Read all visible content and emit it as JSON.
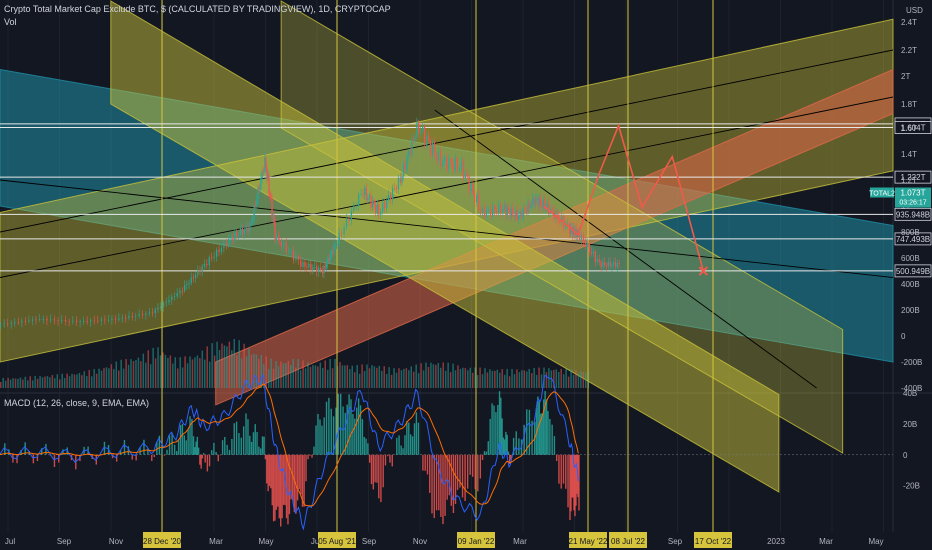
{
  "header": {
    "title": "Crypto Total Market Cap Exclude BTC, $ (CALCULATED BY TRADINGVIEW), 1D, CRYPTOCAP",
    "vol_label": "Vol",
    "macd_label": "MACD (12, 26, close, 9, EMA, EMA)",
    "currency": "USD"
  },
  "chart_data": [
    {
      "type": "candlestick",
      "title": "Crypto Total Market Cap Exclude BTC, $ (CALCULATED BY TRADINGVIEW), 1D, CRYPTOCAP",
      "y_scale": "log",
      "x_range": [
        "2020-07-01",
        "2023-05-31"
      ],
      "y_range": [
        0,
        2.5
      ],
      "y_tick_labels": [
        "2.4T",
        "2.2T",
        "2T",
        "1.8T",
        "1.6T",
        "1.4T",
        "1.2T",
        "1T",
        "800B",
        "600B",
        "400B",
        "200B",
        "0",
        "-200B",
        "-400B"
      ],
      "x_tick_labels": [
        "Jul",
        "Sep",
        "Nov",
        "28 Dec '20",
        "Mar",
        "May",
        "Jul",
        "05 Aug '21",
        "Sep",
        "Nov",
        "09 Jan '22",
        "Mar",
        "21 May '22",
        "08 Jul '22",
        "Sep",
        "17 Oct '22",
        "2023",
        "Mar",
        "May"
      ],
      "highlighted_dates": [
        "28 Dec '20",
        "05 Aug '21",
        "09 Jan '22",
        "21 May '22",
        "08 Jul '22",
        "17 Oct '22"
      ],
      "price_levels": [
        {
          "label": "1.634T",
          "value": 1.634
        },
        {
          "label": "1.604T",
          "value": 1.604
        },
        {
          "label": "1.222T",
          "value": 1.222
        },
        {
          "label": "935.948B",
          "value": 0.936
        },
        {
          "label": "747.493B",
          "value": 0.747
        },
        {
          "label": "500.949B",
          "value": 0.501
        }
      ],
      "current": {
        "symbol": "TOTAL2",
        "value_label": "1.073T",
        "countdown": "03:26:17",
        "value": 1.073
      },
      "series": [
        {
          "name": "TOTAL2 (approx closes, trillions USD)",
          "points": [
            [
              "2020-07-01",
              0.09
            ],
            [
              "2020-08-15",
              0.13
            ],
            [
              "2020-10-01",
              0.11
            ],
            [
              "2020-11-15",
              0.13
            ],
            [
              "2020-12-28",
              0.18
            ],
            [
              "2021-02-01",
              0.35
            ],
            [
              "2021-03-01",
              0.55
            ],
            [
              "2021-04-01",
              0.75
            ],
            [
              "2021-04-25",
              0.85
            ],
            [
              "2021-05-12",
              1.35
            ],
            [
              "2021-05-25",
              0.75
            ],
            [
              "2021-06-25",
              0.55
            ],
            [
              "2021-07-20",
              0.5
            ],
            [
              "2021-08-05",
              0.72
            ],
            [
              "2021-09-05",
              1.12
            ],
            [
              "2021-09-25",
              0.95
            ],
            [
              "2021-10-20",
              1.2
            ],
            [
              "2021-11-10",
              1.62
            ],
            [
              "2021-12-05",
              1.35
            ],
            [
              "2022-01-01",
              1.3
            ],
            [
              "2022-01-25",
              0.95
            ],
            [
              "2022-02-20",
              0.98
            ],
            [
              "2022-03-10",
              0.92
            ],
            [
              "2022-03-30",
              1.05
            ],
            [
              "2022-04-15",
              0.98
            ],
            [
              "2022-05-10",
              0.82
            ],
            [
              "2022-05-21",
              0.78
            ],
            [
              "2022-06-15",
              0.55
            ],
            [
              "2022-07-08",
              0.55
            ]
          ]
        },
        {
          "name": "Projection path",
          "points": [
            [
              "2022-04-10",
              1.0
            ],
            [
              "2022-05-21",
              0.78
            ],
            [
              "2022-06-15",
              1.25
            ],
            [
              "2022-07-08",
              1.62
            ],
            [
              "2022-08-05",
              0.99
            ],
            [
              "2022-09-10",
              1.38
            ],
            [
              "2022-10-17",
              0.5
            ]
          ]
        }
      ],
      "channels": [
        {
          "color": "#1f8fa6",
          "p1": [
            "2020-07-01",
            2.05
          ],
          "p2": [
            "2023-05-31",
            0.85
          ],
          "width": 1.05,
          "opacity": 0.55
        },
        {
          "color": "#c8c23a",
          "p1": [
            "2020-07-01",
            0.95
          ],
          "p2": [
            "2023-05-31",
            2.42
          ],
          "width": 1.15,
          "opacity": 0.42
        },
        {
          "color": "#e06848",
          "p1": [
            "2021-03-15",
            -0.2
          ],
          "p2": [
            "2023-05-31",
            2.05
          ],
          "width": 0.33,
          "opacity": 0.55
        },
        {
          "color": "#c8c23a",
          "p1": [
            "2020-11-10",
            2.55
          ],
          "p2": [
            "2023-01-15",
            -0.45
          ],
          "width": 0.75,
          "opacity": 0.5
        },
        {
          "color": "#c8c23a",
          "p1": [
            "2021-06-01",
            2.55
          ],
          "p2": [
            "2023-04-01",
            0.05
          ],
          "width": 0.95,
          "opacity": 0.32
        }
      ],
      "trend_lines": [
        {
          "p1": [
            "2020-07-01",
            0.8
          ],
          "p2": [
            "2023-05-31",
            2.2
          ]
        },
        {
          "p1": [
            "2020-07-01",
            0.45
          ],
          "p2": [
            "2023-05-31",
            1.85
          ]
        },
        {
          "p1": [
            "2020-07-01",
            1.2
          ],
          "p2": [
            "2023-05-31",
            0.45
          ]
        },
        {
          "p1": [
            "2021-12-01",
            1.75
          ],
          "p2": [
            "2023-03-01",
            -0.4
          ]
        }
      ],
      "markers": [
        {
          "date": "2022-10-17",
          "value": 0.5,
          "shape": "x"
        }
      ]
    },
    {
      "type": "bar",
      "title": "Vol",
      "y_range": [
        0,
        1
      ],
      "values_relative": [
        0.2,
        0.22,
        0.25,
        0.28,
        0.32,
        0.4,
        0.55,
        0.65,
        0.85,
        0.6,
        0.7,
        0.95,
        1.0,
        0.75,
        0.55,
        0.6,
        0.5,
        0.6,
        0.45,
        0.5,
        0.4,
        0.45,
        0.55,
        0.5,
        0.42,
        0.4,
        0.38,
        0.4,
        0.42,
        0.38,
        0.36
      ]
    },
    {
      "type": "line",
      "title": "MACD (12, 26, close, 9, EMA, EMA)",
      "y_range": [
        -50,
        40
      ],
      "y_tick_labels": [
        "40B",
        "20B",
        "0",
        "-20B"
      ],
      "series": [
        {
          "name": "MACD",
          "color": "#2962ff"
        },
        {
          "name": "Signal",
          "color": "#ff6d00"
        },
        {
          "name": "Histogram",
          "color": "#26a69a"
        }
      ],
      "points": [
        [
          "2020-07-01",
          0.5
        ],
        [
          "2020-08-15",
          1.5
        ],
        [
          "2020-10-01",
          -1
        ],
        [
          "2020-11-15",
          2
        ],
        [
          "2020-12-28",
          4
        ],
        [
          "2021-01-25",
          12
        ],
        [
          "2021-02-15",
          30
        ],
        [
          "2021-03-01",
          18
        ],
        [
          "2021-03-25",
          25
        ],
        [
          "2021-04-20",
          45
        ],
        [
          "2021-05-10",
          50
        ],
        [
          "2021-05-25",
          5
        ],
        [
          "2021-06-10",
          -25
        ],
        [
          "2021-06-28",
          -45
        ],
        [
          "2021-07-20",
          -10
        ],
        [
          "2021-08-15",
          20
        ],
        [
          "2021-09-05",
          42
        ],
        [
          "2021-09-25",
          5
        ],
        [
          "2021-10-20",
          20
        ],
        [
          "2021-11-10",
          40
        ],
        [
          "2021-12-05",
          -10
        ],
        [
          "2021-12-28",
          -30
        ],
        [
          "2022-01-25",
          -40
        ],
        [
          "2022-02-15",
          5
        ],
        [
          "2022-03-01",
          -5
        ],
        [
          "2022-03-30",
          25
        ],
        [
          "2022-04-15",
          55
        ],
        [
          "2022-05-10",
          10
        ],
        [
          "2022-05-21",
          -15
        ]
      ]
    }
  ]
}
